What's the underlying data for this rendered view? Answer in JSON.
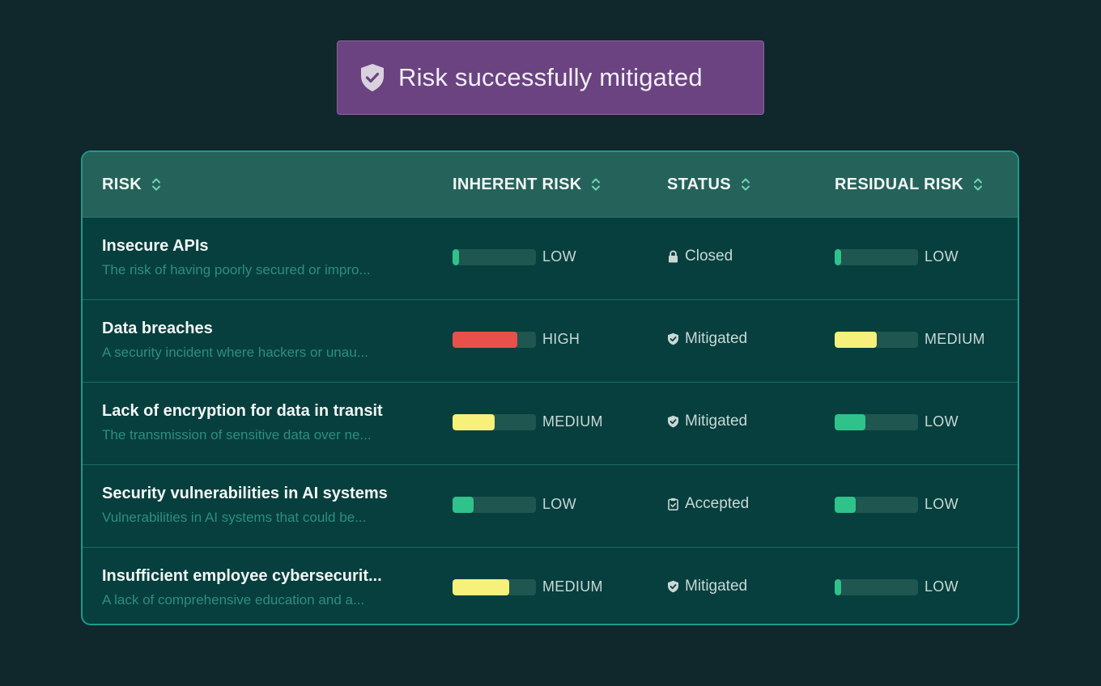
{
  "toast": {
    "message": "Risk successfully mitigated",
    "icon": "shield-check-icon",
    "color": "#6a4380"
  },
  "table": {
    "headers": [
      {
        "label": "RISK",
        "icon": "sort-icon"
      },
      {
        "label": "INHERENT RISK",
        "icon": "sort-icon"
      },
      {
        "label": "STATUS",
        "icon": "sort-icon"
      },
      {
        "label": "RESIDUAL RISK",
        "icon": "sort-icon"
      }
    ],
    "rows": [
      {
        "title": "Insecure APIs",
        "description": "The risk of having poorly secured or impro...",
        "inherent": {
          "level": "LOW",
          "fill": 0.08
        },
        "status": {
          "label": "Closed",
          "icon": "lock-icon"
        },
        "residual": {
          "level": "LOW",
          "fill": 0.08
        }
      },
      {
        "title": "Data breaches",
        "description": "A security incident where hackers or unau...",
        "inherent": {
          "level": "HIGH",
          "fill": 0.78
        },
        "status": {
          "label": "Mitigated",
          "icon": "shield-check-icon"
        },
        "residual": {
          "level": "MEDIUM",
          "fill": 0.5
        }
      },
      {
        "title": "Lack of encryption for data in transit",
        "description": "The transmission of sensitive data over ne...",
        "inherent": {
          "level": "MEDIUM",
          "fill": 0.5
        },
        "status": {
          "label": "Mitigated",
          "icon": "shield-check-icon"
        },
        "residual": {
          "level": "LOW",
          "fill": 0.37
        }
      },
      {
        "title": "Security vulnerabilities in AI systems",
        "description": "Vulnerabilities in AI systems that could be...",
        "inherent": {
          "level": "LOW",
          "fill": 0.25
        },
        "status": {
          "label": "Accepted",
          "icon": "clipboard-check-icon"
        },
        "residual": {
          "level": "LOW",
          "fill": 0.25
        }
      },
      {
        "title": "Insufficient employee cybersecurit...",
        "description": "A lack of comprehensive education and a...",
        "inherent": {
          "level": "MEDIUM",
          "fill": 0.68
        },
        "status": {
          "label": "Mitigated",
          "icon": "shield-check-icon"
        },
        "residual": {
          "level": "LOW",
          "fill": 0.08
        }
      }
    ]
  },
  "colors": {
    "low": "#2fc28a",
    "medium": "#f7f07a",
    "high": "#e9504a"
  }
}
